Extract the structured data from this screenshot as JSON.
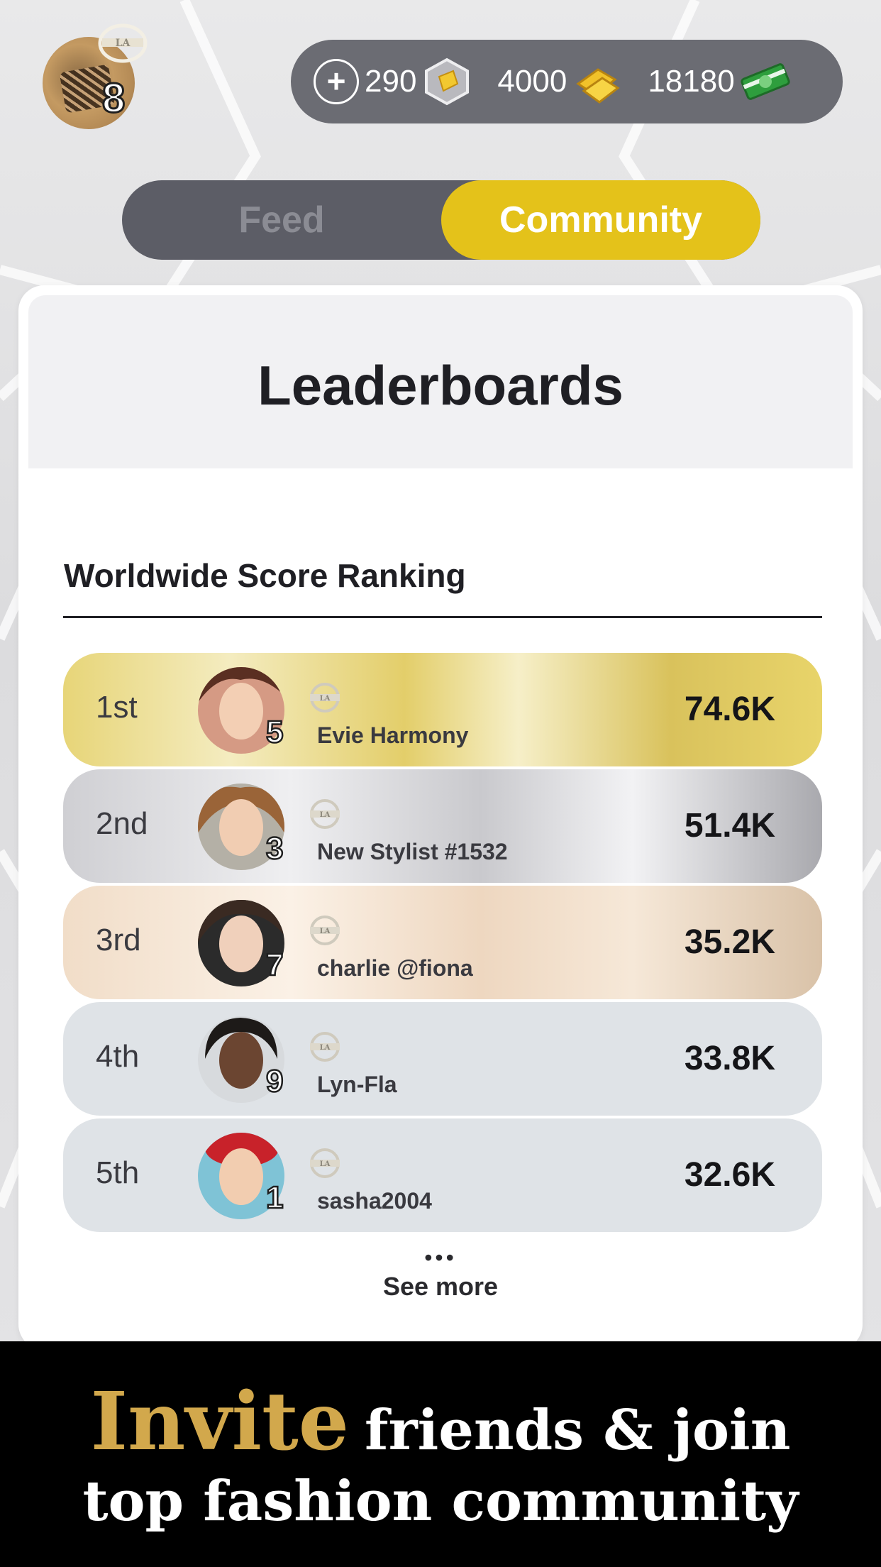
{
  "header": {
    "level": "8",
    "currencies": {
      "plus_label": "+",
      "gems": "290",
      "gold": "4000",
      "cash": "18180"
    }
  },
  "tabs": {
    "feed": "Feed",
    "community": "Community",
    "active": "Community"
  },
  "card": {
    "title": "Leaderboards",
    "section_title": "Worldwide Score Ranking",
    "rows": [
      {
        "rank": "1st",
        "level": "5",
        "name": "Evie Harmony",
        "score": "74.6K"
      },
      {
        "rank": "2nd",
        "level": "3",
        "name": "New Stylist #1532",
        "score": "51.4K"
      },
      {
        "rank": "3rd",
        "level": "7",
        "name": "charlie @fiona",
        "score": "35.2K"
      },
      {
        "rank": "4th",
        "level": "9",
        "name": "Lyn-Fla",
        "score": "33.8K"
      },
      {
        "rank": "5th",
        "level": "1",
        "name": "sasha2004",
        "score": "32.6K"
      }
    ],
    "see_more_dots": "•••",
    "see_more": "See more"
  },
  "banner": {
    "highlight": "Invite",
    "line1_rest": "friends & join",
    "line2": "top fashion community"
  },
  "colors": {
    "toggle_active": "#e4c21a",
    "invite_gold": "#d2a84c",
    "currency_bar": "#6b6c73"
  }
}
